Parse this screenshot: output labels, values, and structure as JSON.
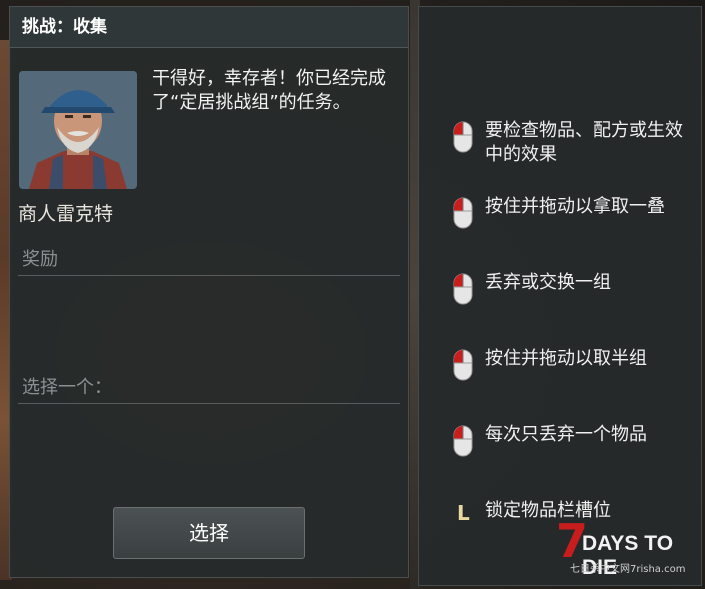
{
  "header": {
    "title": "挑战：收集"
  },
  "npc": {
    "name": "商人雷克特",
    "message": "干得好，幸存者！你已经完成了“定居挑战组”的任务。"
  },
  "rewards_label": "奖励",
  "choose_label": "选择一个：",
  "select_button": "选择",
  "hints": [
    {
      "icon": "mouse-left-click-icon",
      "text": "要检查物品、配方或生效中的效果"
    },
    {
      "icon": "mouse-left-drag-icon",
      "text": "按住并拖动以拿取一叠"
    },
    {
      "icon": "mouse-right-click-icon",
      "text": "丢弃或交换一组"
    },
    {
      "icon": "mouse-right-drag-icon",
      "text": "按住并拖动以取半组"
    },
    {
      "icon": "mouse-middle-click-icon",
      "text": "每次只丢弃一个物品"
    },
    {
      "icon": "key-l",
      "key": "L",
      "text": "锁定物品栏槽位"
    }
  ],
  "logo": {
    "seven": "7",
    "title": "DAYS TO DIE",
    "sub": "七日杀中文网7risha.com"
  },
  "colors": {
    "panel": "#262a2b",
    "accent_red": "#c71d1d",
    "text": "#f0f0f0",
    "muted": "#8c9092"
  }
}
